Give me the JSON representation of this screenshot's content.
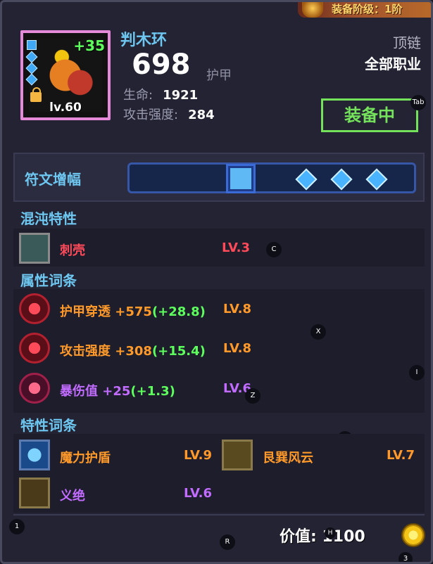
{
  "header": {
    "grade_label": "装备阶级：1阶"
  },
  "item": {
    "name": "判木环",
    "plus": "+35",
    "level": "lv.60",
    "armor_value": "698",
    "armor_label": "护甲",
    "stats": [
      {
        "label": "生命:",
        "value": "1921"
      },
      {
        "label": "攻击强度:",
        "value": "284"
      }
    ],
    "slot": "顶链",
    "class": "全部职业",
    "equipped_label": "装备中"
  },
  "runes": {
    "label": "符文增幅"
  },
  "chaos": {
    "title": "混沌特性",
    "items": [
      {
        "name": "刺壳",
        "level": "LV.3"
      }
    ]
  },
  "attributes": {
    "title": "属性词条",
    "items": [
      {
        "name": "护甲穿透",
        "bonus": "+575",
        "extra": "(+28.8)",
        "level": "LV.8"
      },
      {
        "name": "攻击强度",
        "bonus": "+308",
        "extra": "(+15.4)",
        "level": "LV.8"
      },
      {
        "name": "暴伤值",
        "bonus": "+25",
        "extra": "(+1.3)",
        "level": "LV.6"
      }
    ]
  },
  "traits": {
    "title": "特性词条",
    "items": [
      {
        "name": "魔力护盾",
        "level": "LV.9"
      },
      {
        "name": "艮巽风云",
        "level": "LV.7"
      },
      {
        "name": "义绝",
        "level": "LV.6"
      }
    ]
  },
  "footer": {
    "value_label": "价值:",
    "value": "1100"
  },
  "hotkeys": {
    "tab": "Tab",
    "c": "C",
    "x": "X",
    "z": "Z",
    "i": "I",
    "u": "U",
    "one": "1",
    "r": "R",
    "three": "3",
    "h": "H"
  },
  "colors": {
    "accent_blue": "#6ec7f0",
    "equipped_green": "#74e35b",
    "rarity_pink": "#e48ad8",
    "red": "#ff4a5a",
    "orange": "#ff9a2a",
    "purple": "#c16cff"
  }
}
